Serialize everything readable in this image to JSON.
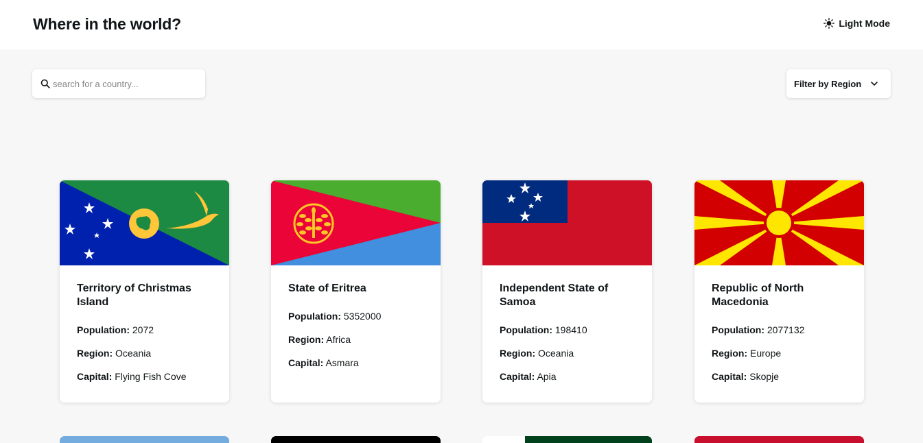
{
  "header": {
    "title": "Where in the world?",
    "mode_label": "Light Mode"
  },
  "search": {
    "placeholder": "search for a country..."
  },
  "filter": {
    "label": "Filter by Region"
  },
  "cards": [
    {
      "name": "Territory of Christmas Island",
      "population_label": "Population:",
      "population": "2072",
      "region_label": "Region:",
      "region": "Oceania",
      "capital_label": "Capital:",
      "capital": "Flying Fish Cove"
    },
    {
      "name": "State of Eritrea",
      "population_label": "Population:",
      "population": "5352000",
      "region_label": "Region:",
      "region": "Africa",
      "capital_label": "Capital:",
      "capital": "Asmara"
    },
    {
      "name": "Independent State of Samoa",
      "population_label": "Population:",
      "population": "198410",
      "region_label": "Region:",
      "region": "Oceania",
      "capital_label": "Capital:",
      "capital": "Apia"
    },
    {
      "name": "Republic of North Macedonia",
      "population_label": "Population:",
      "population": "2077132",
      "region_label": "Region:",
      "region": "Europe",
      "capital_label": "Capital:",
      "capital": "Skopje"
    }
  ],
  "colors": {
    "background": "#f7f7f7",
    "surface": "#ffffff",
    "text": "#111517",
    "placeholder": "#858585"
  }
}
